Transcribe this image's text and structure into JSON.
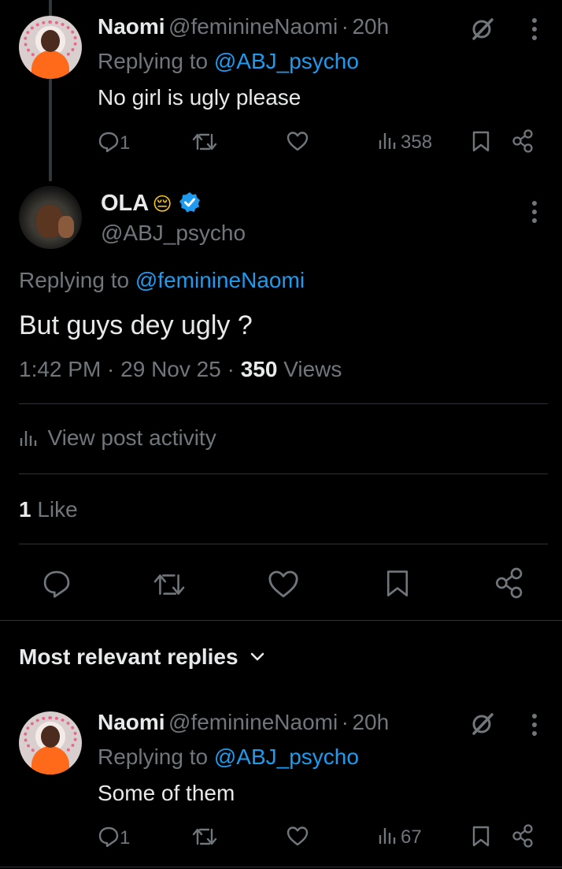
{
  "reply_top": {
    "name": "Naomi",
    "handle": "@feminineNaomi",
    "separator": "·",
    "time": "20h",
    "replying_prefix": "Replying to",
    "replying_to": "@ABJ_psycho",
    "text": "No girl is ugly please",
    "reply_count": "1",
    "views": "358",
    "icons": [
      "grok-icon",
      "more-icon",
      "reply-icon",
      "repost-icon",
      "like-icon",
      "views-icon",
      "bookmark-icon",
      "share-icon"
    ]
  },
  "main_post": {
    "name": "OLA",
    "emoji": "😔",
    "verified": true,
    "handle": "@ABJ_psycho",
    "replying_prefix": "Replying to",
    "replying_to": "@feminineNaomi",
    "text": "But guys dey ugly ?",
    "timestamp": "1:42 PM · 29 Nov 25 ·",
    "views_count": "350",
    "views_label": "Views",
    "activity_label": "View post activity",
    "likes_count": "1",
    "likes_label": "Like",
    "colors": {
      "verified": "#1d9bf0",
      "link": "#1d9bf0",
      "muted": "#71767b"
    }
  },
  "replies_section": {
    "sort_label": "Most relevant replies"
  },
  "reply_bottom": {
    "name": "Naomi",
    "handle": "@feminineNaomi",
    "separator": "·",
    "time": "20h",
    "replying_prefix": "Replying to",
    "replying_to": "@ABJ_psycho",
    "text": "Some of them",
    "reply_count": "1",
    "views": "67"
  }
}
